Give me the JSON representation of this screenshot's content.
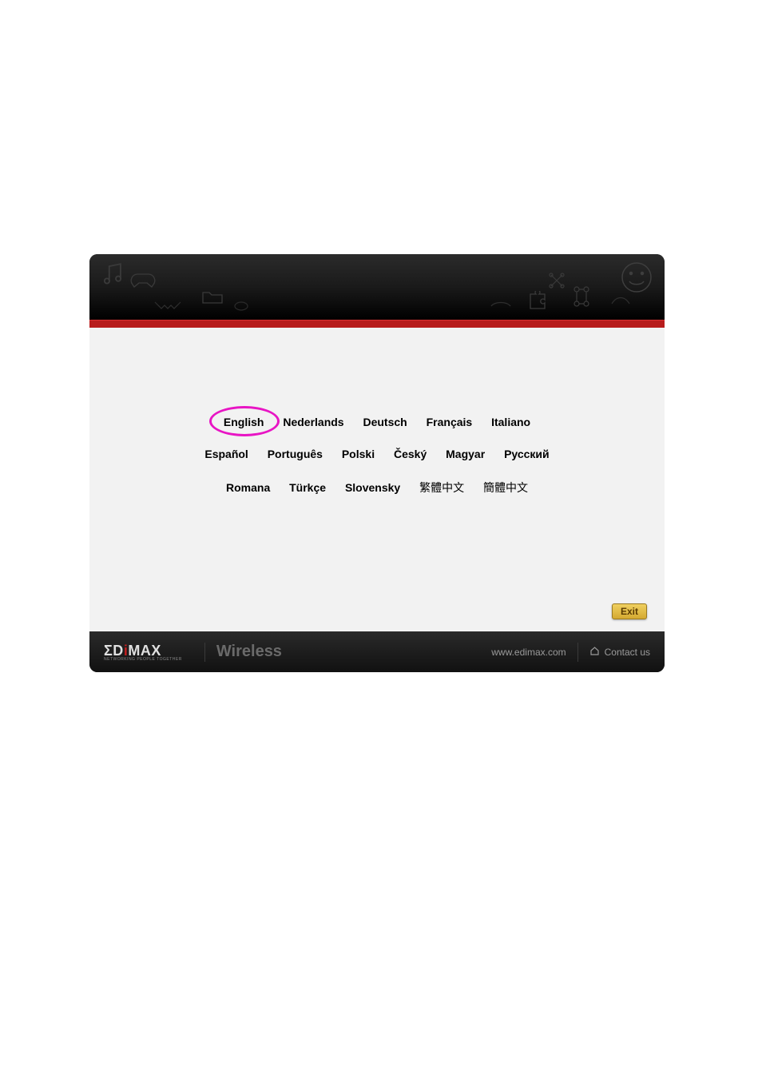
{
  "languages": {
    "row1": [
      "English",
      "Nederlands",
      "Deutsch",
      "Français",
      "Italiano"
    ],
    "row2": [
      "Español",
      "Português",
      "Polski",
      "Český",
      "Magyar",
      "Русский"
    ],
    "row3": [
      "Romana",
      "Türkçe",
      "Slovensky",
      "繁體中文",
      "簡體中文"
    ]
  },
  "highlighted_language": "English",
  "exit_label": "Exit",
  "footer": {
    "brand_prefix": "ΣD",
    "brand_i": "i",
    "brand_suffix": "MAX",
    "brand_tagline": "NETWORKING PEOPLE TOGETHER",
    "category": "Wireless",
    "website": "www.edimax.com",
    "contact": "Contact us"
  },
  "colors": {
    "accent_red": "#b71c1c",
    "highlight_magenta": "#e815c4",
    "exit_gold": "#d4a930"
  }
}
